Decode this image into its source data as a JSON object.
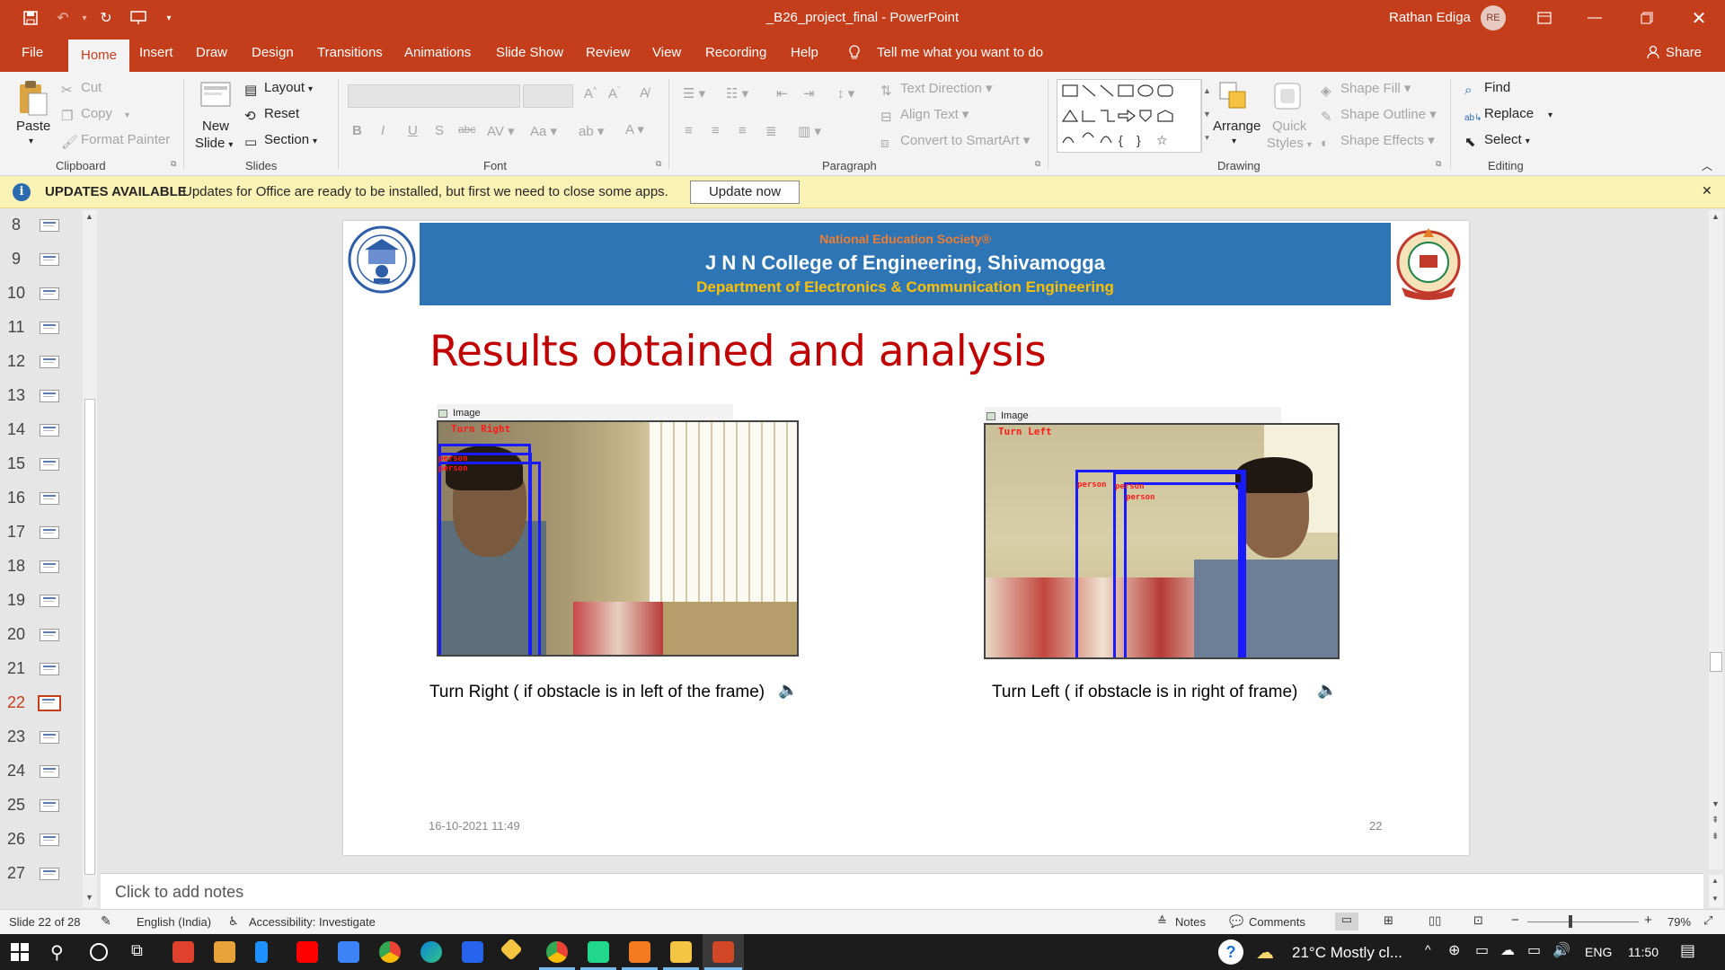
{
  "window": {
    "doc_title": "_B26_project_final  -  PowerPoint",
    "user_name": "Rathan Ediga",
    "user_initials": "RE"
  },
  "tabs": [
    "File",
    "Home",
    "Insert",
    "Draw",
    "Design",
    "Transitions",
    "Animations",
    "Slide Show",
    "Review",
    "View",
    "Recording",
    "Help"
  ],
  "active_tab": "Home",
  "tell_me": "Tell me what you want to do",
  "share": "Share",
  "ribbon": {
    "clipboard": {
      "label": "Clipboard",
      "paste": "Paste",
      "cut": "Cut",
      "copy": "Copy",
      "format_painter": "Format Painter"
    },
    "slides": {
      "label": "Slides",
      "new_slide_1": "New",
      "new_slide_2": "Slide",
      "layout": "Layout",
      "reset": "Reset",
      "section": "Section"
    },
    "font": {
      "label": "Font"
    },
    "paragraph": {
      "label": "Paragraph",
      "text_direction": "Text Direction",
      "align_text": "Align Text",
      "convert_smartart": "Convert to SmartArt"
    },
    "drawing": {
      "label": "Drawing",
      "arrange": "Arrange",
      "quick_styles_1": "Quick",
      "quick_styles_2": "Styles",
      "shape_fill": "Shape Fill",
      "shape_outline": "Shape Outline",
      "shape_effects": "Shape Effects"
    },
    "editing": {
      "label": "Editing",
      "find": "Find",
      "replace": "Replace",
      "select": "Select"
    }
  },
  "update_bar": {
    "title": "UPDATES AVAILABLE",
    "message": "Updates for Office are ready to be installed, but first we need to close some apps.",
    "button": "Update now"
  },
  "thumbnails": [
    "8",
    "9",
    "10",
    "11",
    "12",
    "13",
    "14",
    "15",
    "16",
    "17",
    "18",
    "19",
    "20",
    "21",
    "22",
    "23",
    "24",
    "25",
    "26",
    "27"
  ],
  "active_thumbnail": "22",
  "slide": {
    "header_line1": "National Education Society®",
    "header_line2": "J N N College of Engineering, Shivamogga",
    "header_line3": "Department of Electronics & Communication Engineering",
    "title": "Results obtained and analysis",
    "left_image": {
      "window_label": "Image",
      "overlay": "Turn Right",
      "box_label": "person",
      "caption": "Turn Right ( if obstacle is in left of the frame)"
    },
    "right_image": {
      "window_label": "Image",
      "overlay": "Turn Left",
      "box_label": "person",
      "caption": "Turn Left ( if obstacle is in right of frame)"
    },
    "date": "16-10-2021 11:49",
    "page_number": "22"
  },
  "notes_placeholder": "Click to add notes",
  "status": {
    "slide_info": "Slide 22 of 28",
    "language": "English (India)",
    "accessibility": "Accessibility: Investigate",
    "notes": "Notes",
    "comments": "Comments",
    "zoom": "79%"
  },
  "taskbar": {
    "weather": "21°C  Mostly cl...",
    "lang": "ENG",
    "time": "11:50"
  },
  "colors": {
    "accent": "#c43e1c",
    "slide_banner": "#2e75b6",
    "slide_title": "#c00000",
    "banner_orange": "#ed7d31",
    "banner_yellow": "#ffc000"
  }
}
